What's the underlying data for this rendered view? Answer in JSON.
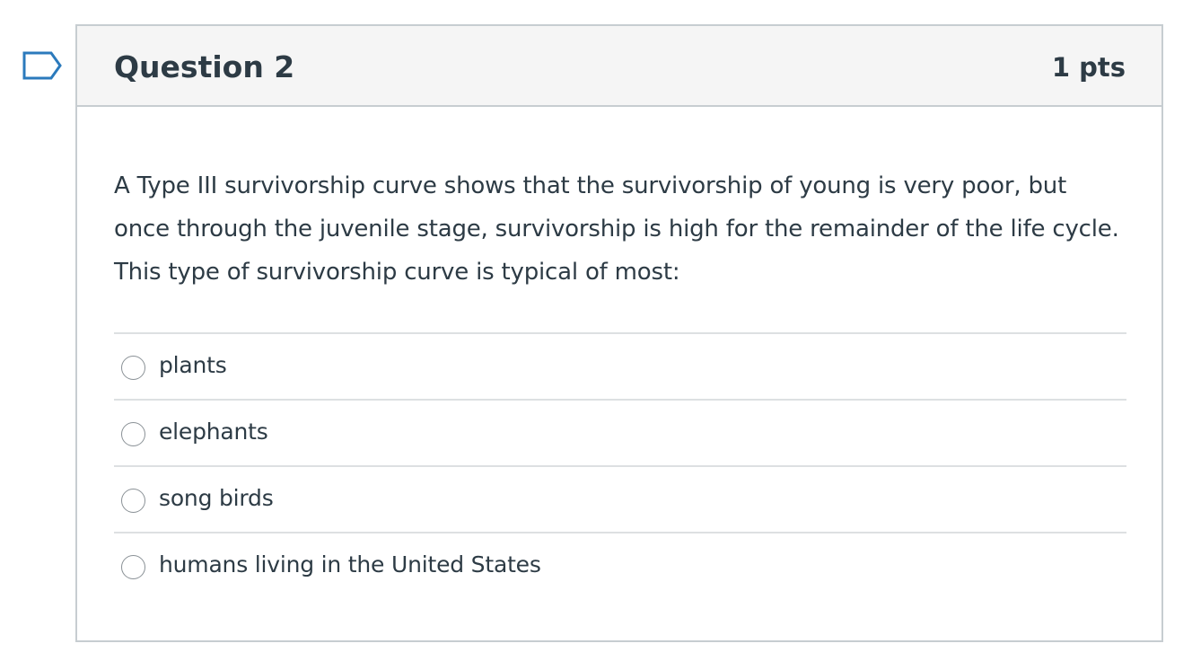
{
  "question": {
    "title": "Question 2",
    "points": "1 pts",
    "flag_icon": "bookmark-flag-icon",
    "text": "A Type III survivorship curve shows that the survivorship of young is very poor, but once through the juvenile stage, survivorship is high for the remainder of the life cycle. This type of survivorship curve is typical of most:",
    "answers": [
      {
        "label": "plants",
        "selected": false
      },
      {
        "label": "elephants",
        "selected": false
      },
      {
        "label": "song birds",
        "selected": false
      },
      {
        "label": "humans living in the United States",
        "selected": false
      }
    ]
  },
  "colors": {
    "text": "#2d3b45",
    "header_bg": "#f5f5f5",
    "border": "#c7cdd1",
    "divider": "#dde0e2",
    "flag": "#2b7abc"
  }
}
